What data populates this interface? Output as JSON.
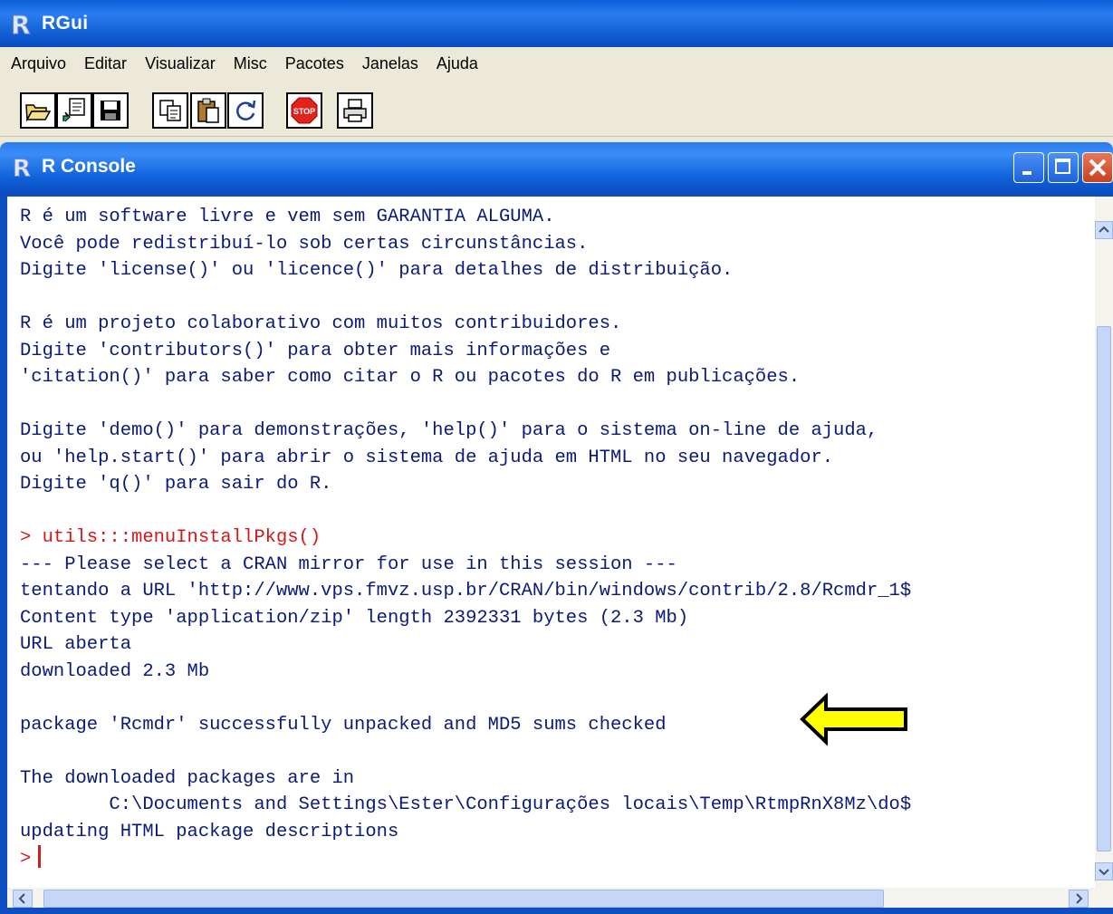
{
  "app": {
    "title": "RGui"
  },
  "menu": {
    "items": [
      "Arquivo",
      "Editar",
      "Visualizar",
      "Misc",
      "Pacotes",
      "Janelas",
      "Ajuda"
    ]
  },
  "toolbar": {
    "icons": [
      "open-script-icon",
      "load-workspace-icon",
      "save-icon",
      "copy-icon",
      "paste-icon",
      "refresh-icon",
      "stop-icon",
      "print-icon"
    ],
    "stop_label": "STOP"
  },
  "console": {
    "title": "R Console",
    "lines": [
      {
        "text": "R é um software livre e vem sem GARANTIA ALGUMA.",
        "kind": "output"
      },
      {
        "text": "Você pode redistribuí-lo sob certas circunstâncias.",
        "kind": "output"
      },
      {
        "text": "Digite 'license()' ou 'licence()' para detalhes de distribuição.",
        "kind": "output"
      },
      {
        "text": "",
        "kind": "output"
      },
      {
        "text": "R é um projeto colaborativo com muitos contribuidores.",
        "kind": "output"
      },
      {
        "text": "Digite 'contributors()' para obter mais informações e",
        "kind": "output"
      },
      {
        "text": "'citation()' para saber como citar o R ou pacotes do R em publicações.",
        "kind": "output"
      },
      {
        "text": "",
        "kind": "output"
      },
      {
        "text": "Digite 'demo()' para demonstrações, 'help()' para o sistema on-line de ajuda,",
        "kind": "output"
      },
      {
        "text": "ou 'help.start()' para abrir o sistema de ajuda em HTML no seu navegador.",
        "kind": "output"
      },
      {
        "text": "Digite 'q()' para sair do R.",
        "kind": "output"
      },
      {
        "text": "",
        "kind": "output"
      },
      {
        "text": "> utils:::menuInstallPkgs()",
        "kind": "command"
      },
      {
        "text": "--- Please select a CRAN mirror for use in this session ---",
        "kind": "output"
      },
      {
        "text": "tentando a URL 'http://www.vps.fmvz.usp.br/CRAN/bin/windows/contrib/2.8/Rcmdr_1$",
        "kind": "output"
      },
      {
        "text": "Content type 'application/zip' length 2392331 bytes (2.3 Mb)",
        "kind": "output"
      },
      {
        "text": "URL aberta",
        "kind": "output"
      },
      {
        "text": "downloaded 2.3 Mb",
        "kind": "output"
      },
      {
        "text": "",
        "kind": "output"
      },
      {
        "text": "package 'Rcmdr' successfully unpacked and MD5 sums checked",
        "kind": "output"
      },
      {
        "text": "",
        "kind": "output"
      },
      {
        "text": "The downloaded packages are in",
        "kind": "output"
      },
      {
        "text": "        C:\\Documents and Settings\\Ester\\Configurações locais\\Temp\\RtmpRnX8Mz\\do$",
        "kind": "output"
      },
      {
        "text": "updating HTML package descriptions",
        "kind": "output"
      }
    ],
    "prompt": ">"
  },
  "colors": {
    "title_blue": "#0a5fd8",
    "command_red": "#d41818",
    "output_blue": "#0a1a7a",
    "annotation_arrow": "#ffff00"
  }
}
